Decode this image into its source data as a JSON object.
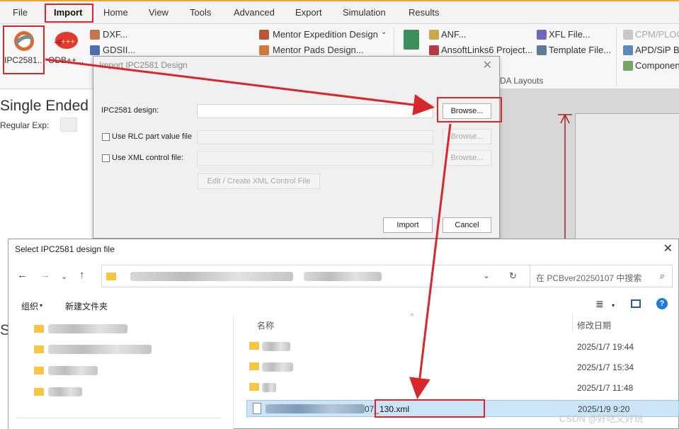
{
  "ribbon": {
    "tabs": [
      "File",
      "Import",
      "Home",
      "View",
      "Tools",
      "Advanced",
      "Export",
      "Simulation",
      "Results"
    ],
    "active_tab": "Import",
    "ipc_button": "IPC2581..",
    "odb_button": "ODB++...",
    "dxf": "DXF...",
    "gdsii": "GDSII...",
    "mentor_expedition": "Mentor Expedition Design",
    "mentor_pads": "Mentor Pads Design...",
    "anf": "ANF...",
    "ansoftlinks": "AnsoftLinks6 Project...",
    "xfl": "XFL File...",
    "template": "Template File...",
    "cpm": "CPM/PLOC",
    "apd": "APD/SiP Bo",
    "component": "Componen",
    "group_label": "DA Layouts"
  },
  "app": {
    "panel_title": "Single Ended N",
    "regexp_label": "Regular Exp:",
    "side_fragment": "Se"
  },
  "import_dialog": {
    "title": "Import IPC2581 Design",
    "design_label": "IPC2581 design:",
    "rlc_label": "Use RLC part value file",
    "xml_label": "Use XML control file:",
    "browse": "Browse...",
    "edit_xml": "Edit / Create XML Control File",
    "import": "Import",
    "cancel": "Cancel"
  },
  "file_dialog": {
    "title": "Select IPC2581 design file",
    "search_placeholder": "在 PCBver20250107 中搜索",
    "organize": "组织",
    "new_folder": "新建文件夹",
    "col_name": "名称",
    "col_date": "修改日期",
    "rows": [
      {
        "type": "folder",
        "date": "2025/1/7 19:44"
      },
      {
        "type": "folder",
        "date": "2025/1/7 15:34"
      },
      {
        "type": "folder",
        "date": "2025/1/7 11:48"
      },
      {
        "type": "file",
        "name_visible": "130.xml",
        "prefix_visible": "07_",
        "date": "2025/1/9 9:20",
        "selected": true
      }
    ]
  },
  "watermark": "CSDN @好吃又好玩",
  "colors": {
    "accent": "#f0a330",
    "highlight": "#d9262a",
    "selection": "#cce4f7"
  }
}
